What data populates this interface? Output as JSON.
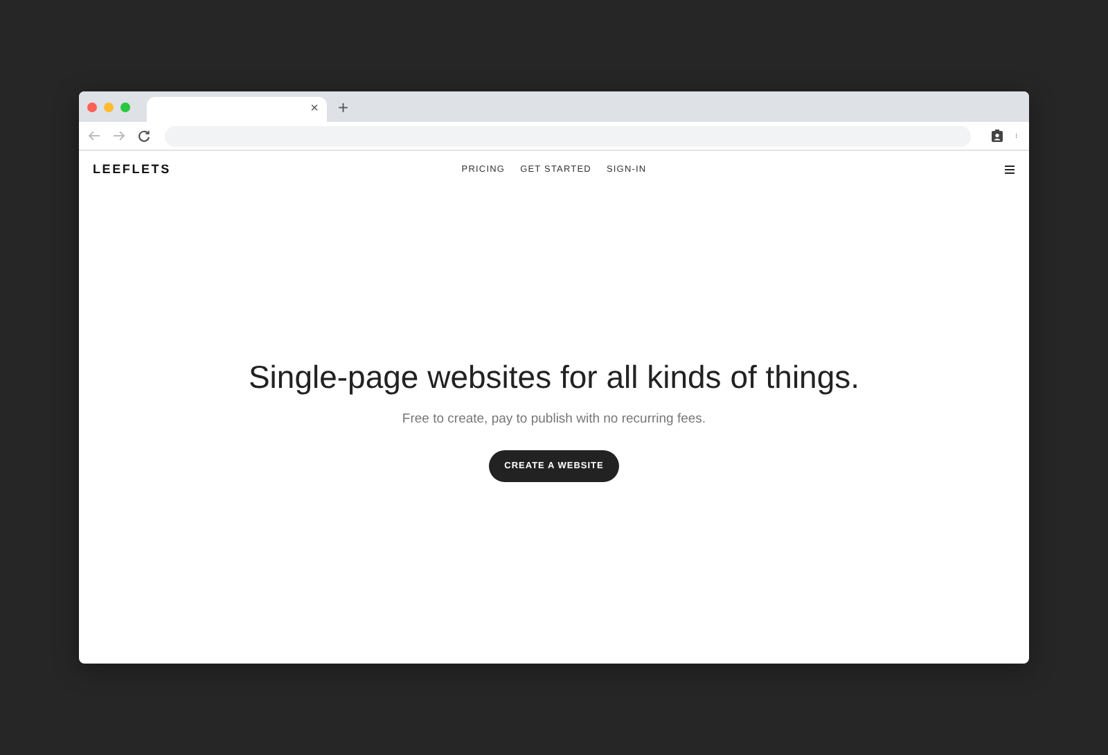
{
  "browser": {
    "tab_close": "×",
    "new_tab": "+"
  },
  "site": {
    "logo": "LEEFLETS",
    "nav": [
      "PRICING",
      "GET STARTED",
      "SIGN-IN"
    ],
    "hero": {
      "headline": "Single-page websites for all kinds of things.",
      "subtitle": "Free to create, pay to publish with no recurring fees.",
      "cta": "CREATE A WEBSITE"
    }
  }
}
